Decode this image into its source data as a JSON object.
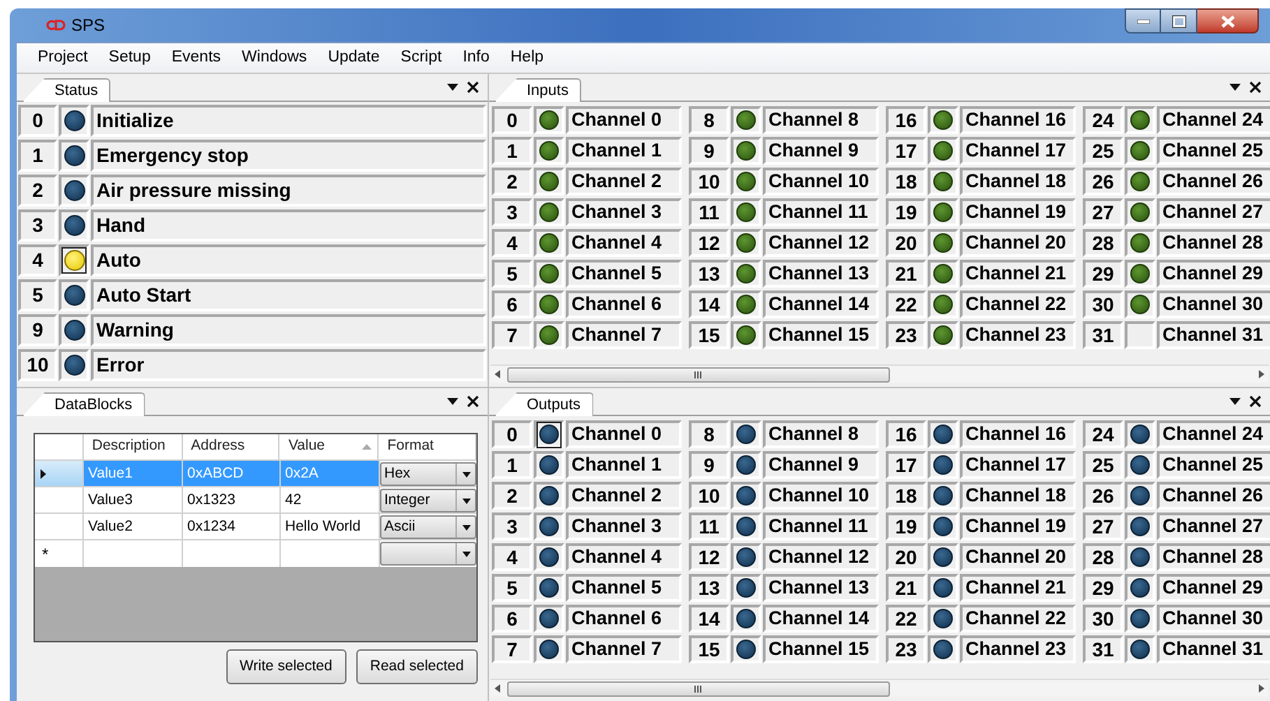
{
  "window": {
    "title": "SPS"
  },
  "menu": [
    "Project",
    "Setup",
    "Events",
    "Windows",
    "Update",
    "Script",
    "Info",
    "Help"
  ],
  "status": {
    "tab": "Status",
    "items": [
      {
        "index": "0",
        "label": "Initialize",
        "lit": false,
        "focused": false
      },
      {
        "index": "1",
        "label": "Emergency stop",
        "lit": false,
        "focused": false
      },
      {
        "index": "2",
        "label": "Air pressure missing",
        "lit": false,
        "focused": false
      },
      {
        "index": "3",
        "label": "Hand",
        "lit": false,
        "focused": false
      },
      {
        "index": "4",
        "label": "Auto",
        "lit": true,
        "focused": true
      },
      {
        "index": "5",
        "label": "Auto Start",
        "lit": false,
        "focused": false
      },
      {
        "index": "9",
        "label": "Warning",
        "lit": false,
        "focused": false
      },
      {
        "index": "10",
        "label": "Error",
        "lit": false,
        "focused": false
      }
    ]
  },
  "datablocks": {
    "tab": "DataBlocks",
    "columns": [
      {
        "label": "Description",
        "sorted": false
      },
      {
        "label": "Address",
        "sorted": false
      },
      {
        "label": "Value",
        "sorted": true
      },
      {
        "label": "Format",
        "sorted": false
      }
    ],
    "rows": [
      {
        "description": "Value1",
        "address": "0xABCD",
        "value": "0x2A",
        "format": "Hex",
        "selected": true
      },
      {
        "description": "Value3",
        "address": "0x1323",
        "value": "42",
        "format": "Integer",
        "selected": false
      },
      {
        "description": "Value2",
        "address": "0x1234",
        "value": "Hello World",
        "format": "Ascii",
        "selected": false
      }
    ],
    "new_row": {
      "marker": "*"
    },
    "buttons": [
      "Write selected",
      "Read selected"
    ]
  },
  "inputs": {
    "tab": "Inputs",
    "kind": "input",
    "channels": [
      {
        "index": "0",
        "label": "Channel 0",
        "lit": true,
        "focused": false
      },
      {
        "index": "1",
        "label": "Channel 1",
        "lit": true,
        "focused": false
      },
      {
        "index": "2",
        "label": "Channel 2",
        "lit": true,
        "focused": false
      },
      {
        "index": "3",
        "label": "Channel 3",
        "lit": true,
        "focused": false
      },
      {
        "index": "4",
        "label": "Channel 4",
        "lit": true,
        "focused": false
      },
      {
        "index": "5",
        "label": "Channel 5",
        "lit": true,
        "focused": false
      },
      {
        "index": "6",
        "label": "Channel 6",
        "lit": true,
        "focused": false
      },
      {
        "index": "7",
        "label": "Channel 7",
        "lit": true,
        "focused": false
      },
      {
        "index": "8",
        "label": "Channel 8",
        "lit": true,
        "focused": false
      },
      {
        "index": "9",
        "label": "Channel 9",
        "lit": true,
        "focused": false
      },
      {
        "index": "10",
        "label": "Channel 10",
        "lit": true,
        "focused": false
      },
      {
        "index": "11",
        "label": "Channel 11",
        "lit": true,
        "focused": false
      },
      {
        "index": "12",
        "label": "Channel 12",
        "lit": true,
        "focused": false
      },
      {
        "index": "13",
        "label": "Channel 13",
        "lit": true,
        "focused": false
      },
      {
        "index": "14",
        "label": "Channel 14",
        "lit": true,
        "focused": false
      },
      {
        "index": "15",
        "label": "Channel 15",
        "lit": true,
        "focused": false
      },
      {
        "index": "16",
        "label": "Channel 16",
        "lit": true,
        "focused": false
      },
      {
        "index": "17",
        "label": "Channel 17",
        "lit": true,
        "focused": false
      },
      {
        "index": "18",
        "label": "Channel 18",
        "lit": true,
        "focused": false
      },
      {
        "index": "19",
        "label": "Channel 19",
        "lit": true,
        "focused": false
      },
      {
        "index": "20",
        "label": "Channel 20",
        "lit": true,
        "focused": false
      },
      {
        "index": "21",
        "label": "Channel 21",
        "lit": true,
        "focused": false
      },
      {
        "index": "22",
        "label": "Channel 22",
        "lit": true,
        "focused": false
      },
      {
        "index": "23",
        "label": "Channel 23",
        "lit": true,
        "focused": false
      },
      {
        "index": "24",
        "label": "Channel 24",
        "lit": true,
        "focused": false
      },
      {
        "index": "25",
        "label": "Channel 25",
        "lit": true,
        "focused": false
      },
      {
        "index": "26",
        "label": "Channel 26",
        "lit": true,
        "focused": false
      },
      {
        "index": "27",
        "label": "Channel 27",
        "lit": true,
        "focused": false
      },
      {
        "index": "28",
        "label": "Channel 28",
        "lit": true,
        "focused": false
      },
      {
        "index": "29",
        "label": "Channel 29",
        "lit": true,
        "focused": false
      },
      {
        "index": "30",
        "label": "Channel 30",
        "lit": true,
        "focused": false
      },
      {
        "index": "31",
        "label": "Channel 31",
        "lit": false,
        "focused": false
      }
    ]
  },
  "outputs": {
    "tab": "Outputs",
    "kind": "output",
    "channels": [
      {
        "index": "0",
        "label": "Channel 0",
        "lit": false,
        "focused": true
      },
      {
        "index": "1",
        "label": "Channel 1",
        "lit": false,
        "focused": false
      },
      {
        "index": "2",
        "label": "Channel 2",
        "lit": false,
        "focused": false
      },
      {
        "index": "3",
        "label": "Channel 3",
        "lit": false,
        "focused": false
      },
      {
        "index": "4",
        "label": "Channel 4",
        "lit": false,
        "focused": false
      },
      {
        "index": "5",
        "label": "Channel 5",
        "lit": false,
        "focused": false
      },
      {
        "index": "6",
        "label": "Channel 6",
        "lit": false,
        "focused": false
      },
      {
        "index": "7",
        "label": "Channel 7",
        "lit": false,
        "focused": false
      },
      {
        "index": "8",
        "label": "Channel 8",
        "lit": false,
        "focused": false
      },
      {
        "index": "9",
        "label": "Channel 9",
        "lit": false,
        "focused": false
      },
      {
        "index": "10",
        "label": "Channel 10",
        "lit": false,
        "focused": false
      },
      {
        "index": "11",
        "label": "Channel 11",
        "lit": false,
        "focused": false
      },
      {
        "index": "12",
        "label": "Channel 12",
        "lit": false,
        "focused": false
      },
      {
        "index": "13",
        "label": "Channel 13",
        "lit": false,
        "focused": false
      },
      {
        "index": "14",
        "label": "Channel 14",
        "lit": false,
        "focused": false
      },
      {
        "index": "15",
        "label": "Channel 15",
        "lit": false,
        "focused": false
      },
      {
        "index": "16",
        "label": "Channel 16",
        "lit": false,
        "focused": false
      },
      {
        "index": "17",
        "label": "Channel 17",
        "lit": false,
        "focused": false
      },
      {
        "index": "18",
        "label": "Channel 18",
        "lit": false,
        "focused": false
      },
      {
        "index": "19",
        "label": "Channel 19",
        "lit": false,
        "focused": false
      },
      {
        "index": "20",
        "label": "Channel 20",
        "lit": false,
        "focused": false
      },
      {
        "index": "21",
        "label": "Channel 21",
        "lit": false,
        "focused": false
      },
      {
        "index": "22",
        "label": "Channel 22",
        "lit": false,
        "focused": false
      },
      {
        "index": "23",
        "label": "Channel 23",
        "lit": false,
        "focused": false
      },
      {
        "index": "24",
        "label": "Channel 24",
        "lit": false,
        "focused": false
      },
      {
        "index": "25",
        "label": "Channel 25",
        "lit": false,
        "focused": false
      },
      {
        "index": "26",
        "label": "Channel 26",
        "lit": false,
        "focused": false
      },
      {
        "index": "27",
        "label": "Channel 27",
        "lit": false,
        "focused": false
      },
      {
        "index": "28",
        "label": "Channel 28",
        "lit": false,
        "focused": false
      },
      {
        "index": "29",
        "label": "Channel 29",
        "lit": false,
        "focused": false
      },
      {
        "index": "30",
        "label": "Channel 30",
        "lit": false,
        "focused": false
      },
      {
        "index": "31",
        "label": "Channel 31",
        "lit": false,
        "focused": false
      }
    ]
  }
}
